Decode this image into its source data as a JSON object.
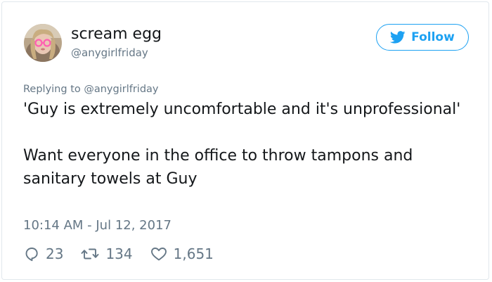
{
  "tweet": {
    "author": {
      "display_name": "scream egg",
      "handle": "@anygirlfriday"
    },
    "follow_button": {
      "label": "Follow"
    },
    "replying_to": {
      "prefix": "Replying to",
      "handle": "@anygirlfriday"
    },
    "paragraphs": [
      "'Guy is extremely uncomfortable and it's unprofessional'",
      "Want everyone in the office to throw tampons and sanitary towels at Guy"
    ],
    "timestamp": "10:14 AM - Jul 12, 2017",
    "stats": {
      "replies": "23",
      "retweets": "134",
      "likes": "1,651"
    }
  },
  "icons": {
    "follow": "twitter-bird-icon",
    "reply": "reply-icon",
    "retweet": "retweet-icon",
    "like": "heart-icon"
  },
  "colors": {
    "accent": "#1da1f2",
    "text_primary": "#14171a",
    "text_secondary": "#657786",
    "border": "#e1e8ed"
  }
}
